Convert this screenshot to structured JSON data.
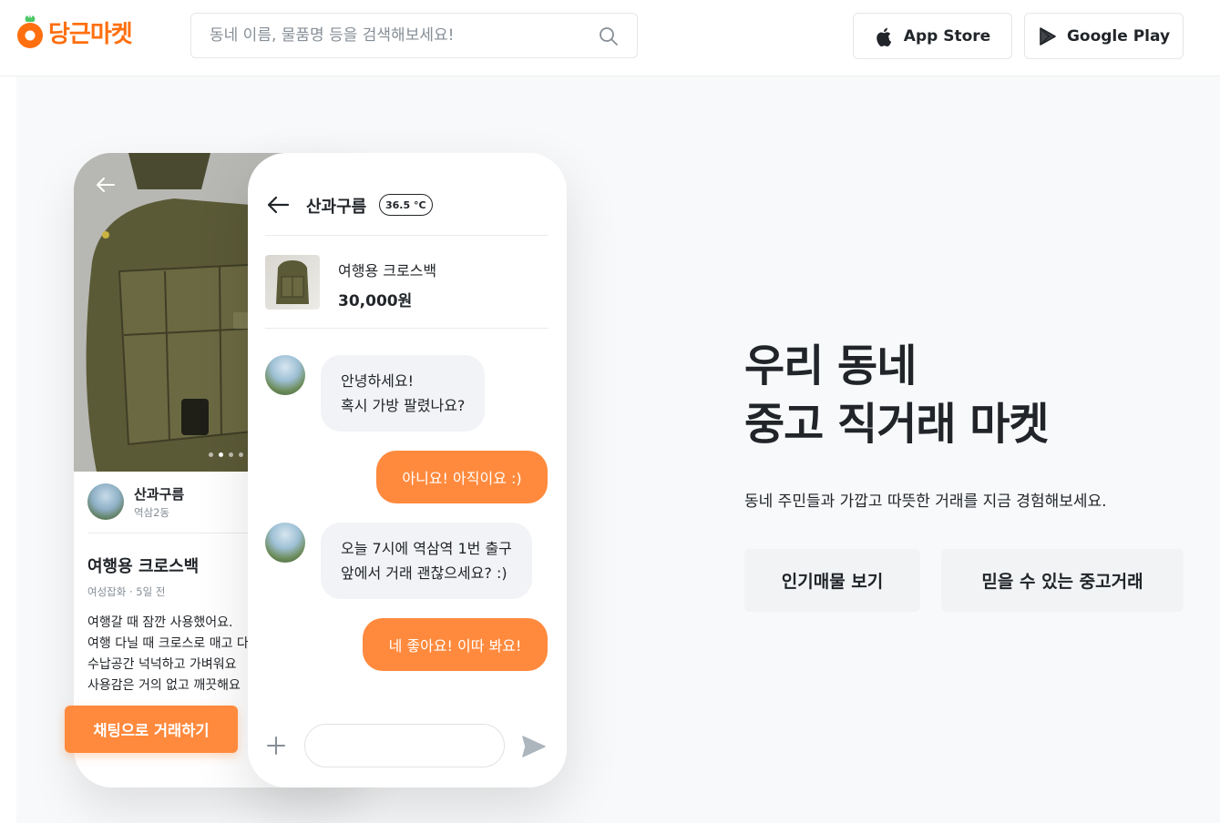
{
  "header": {
    "logo_text": "당근마켓",
    "search_placeholder": "동네 이름, 물품명 등을 검색해보세요!",
    "app_store_label": "App Store",
    "google_play_label": "Google Play"
  },
  "hero": {
    "headline_line1": "우리 동네",
    "headline_line2": "중고 직거래 마켓",
    "subtext": "동네 주민들과 가깝고 따뜻한 거래를 지금 경험해보세요.",
    "buttons": {
      "popular": "인기매물 보기",
      "trusted": "믿을 수 있는 중고거래"
    }
  },
  "product_phone": {
    "seller_name": "산과구름",
    "seller_location": "역삼2동",
    "title": "여행용 크로스백",
    "meta": "여성잡화 · 5일 전",
    "description": [
      "여행갈 때 잠깐 사용했어요.",
      "여행 다닐 때 크로스로 매고 다",
      "수납공간 넉넉하고 가벼워요",
      "사용감은 거의 없고 깨끗해요"
    ],
    "cta": "채팅으로 거래하기"
  },
  "chat_phone": {
    "partner_name": "산과구름",
    "temperature": "36.5 °C",
    "product_title": "여행용 크로스백",
    "product_price": "30,000원",
    "messages": {
      "m1_line1": "안녕하세요!",
      "m1_line2": "혹시 가방 팔렸나요?",
      "m2": "아니요! 아직이요 :)",
      "m3_line1": "오늘 7시에 역삼역 1번 출구",
      "m3_line2": "앞에서 거래 괜찮으세요? :)",
      "m4": "네 좋아요! 이따 봐요!"
    }
  },
  "colors": {
    "brand_orange": "#ff6f0f",
    "bubble_orange": "#ff8a3d",
    "text_dark": "#212529",
    "gray_bg": "#f1f3f5"
  }
}
